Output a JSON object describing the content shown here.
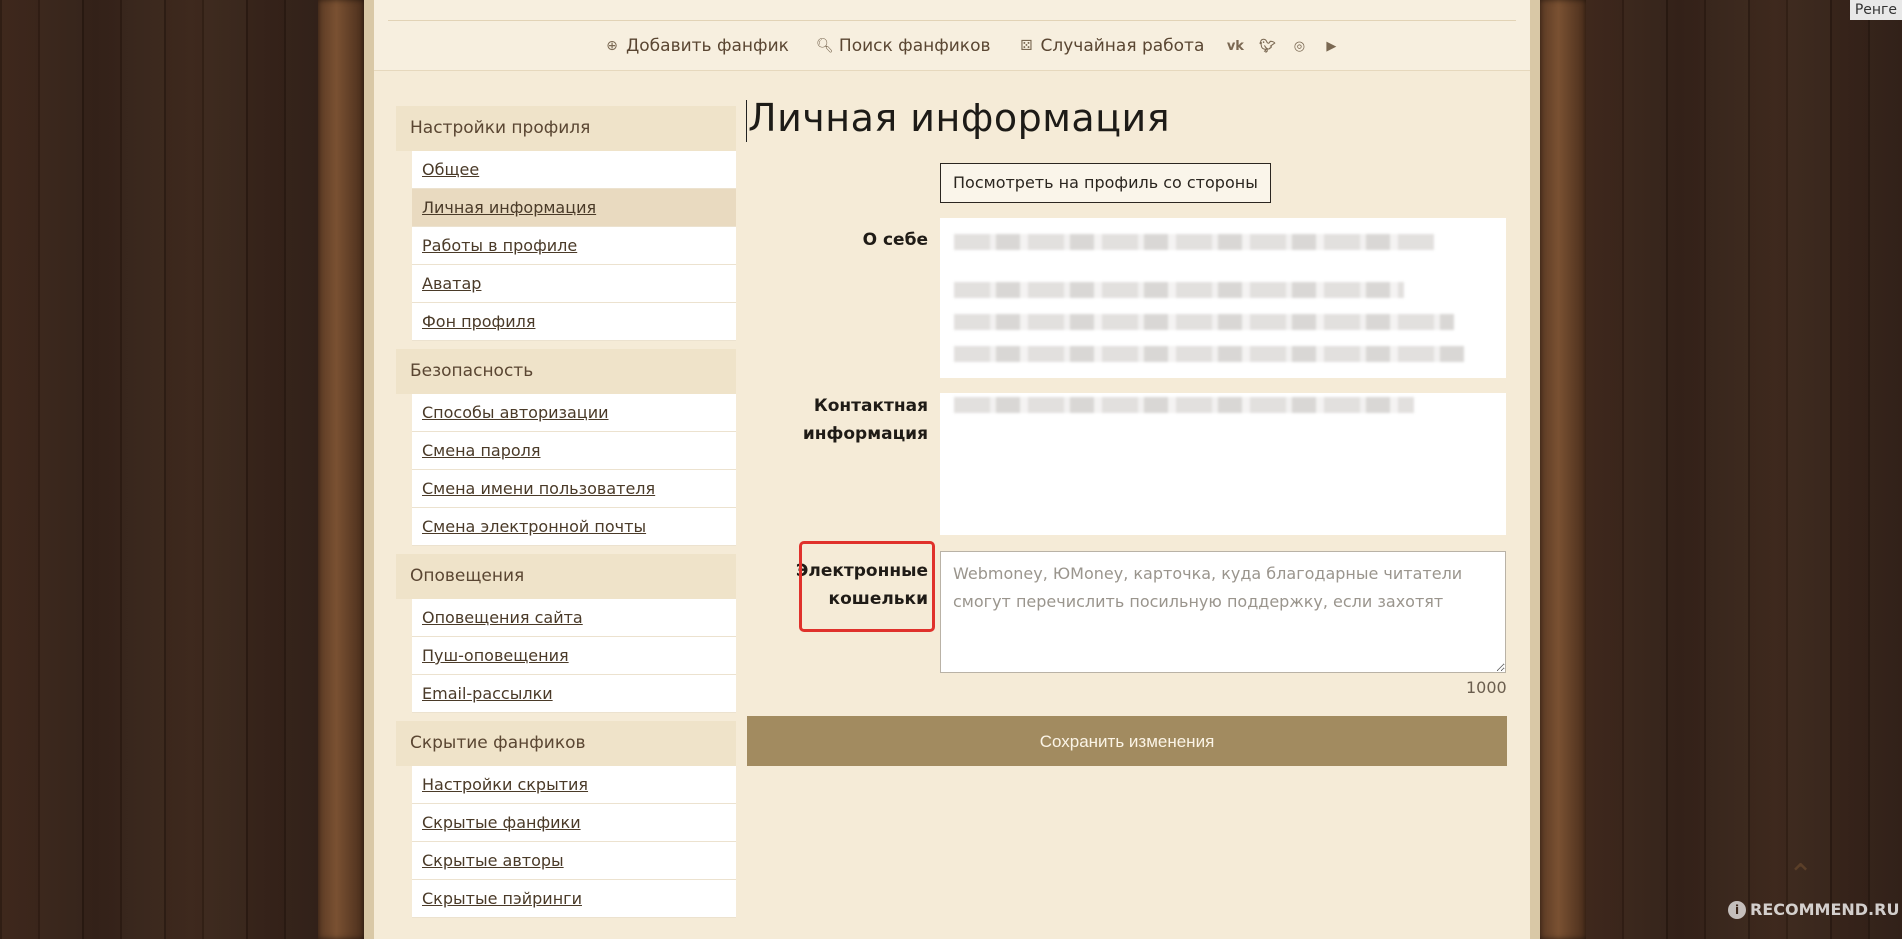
{
  "corner_label": "Ренге",
  "topnav": {
    "add_fanfic": "Добавить фанфик",
    "search_fanfics": "Поиск фанфиков",
    "random_work": "Случайная работа",
    "socials": [
      "vk-icon",
      "twitter-icon",
      "instagram-icon",
      "youtube-icon"
    ]
  },
  "sidebar": {
    "sections": [
      {
        "title": "Настройки профиля",
        "items": [
          "Общее",
          "Личная информация",
          "Работы в профиле",
          "Аватар",
          "Фон профиля"
        ],
        "active": 1
      },
      {
        "title": "Безопасность",
        "items": [
          "Способы авторизации",
          "Смена пароля",
          "Смена имени пользователя",
          "Смена электронной почты"
        ]
      },
      {
        "title": "Оповещения",
        "items": [
          "Оповещения сайта",
          "Пуш-оповещения",
          "Email-рассылки"
        ]
      },
      {
        "title": "Скрытие фанфиков",
        "items": [
          "Настройки скрытия",
          "Скрытые фанфики",
          "Скрытые авторы",
          "Скрытые пэйринги"
        ]
      }
    ]
  },
  "main": {
    "title": "Личная информация",
    "view_profile_button": "Посмотреть на профиль со стороны",
    "about_label": "О себе",
    "contact_label_1": "Контактная",
    "contact_label_2": "информация",
    "wallets_label_1": "Электронные",
    "wallets_label_2": "кошельки",
    "wallets_placeholder": "Webmoney, ЮMoney, карточка, куда благодарные читатели смогут перечислить посильную поддержку, если захотят",
    "wallets_counter": "1000",
    "save_button": "Сохранить изменения"
  },
  "watermark": "RECOMMEND.RU",
  "colors": {
    "accent": "#a28b60",
    "highlight": "#e0312b",
    "page_bg": "#f5ebd7"
  }
}
